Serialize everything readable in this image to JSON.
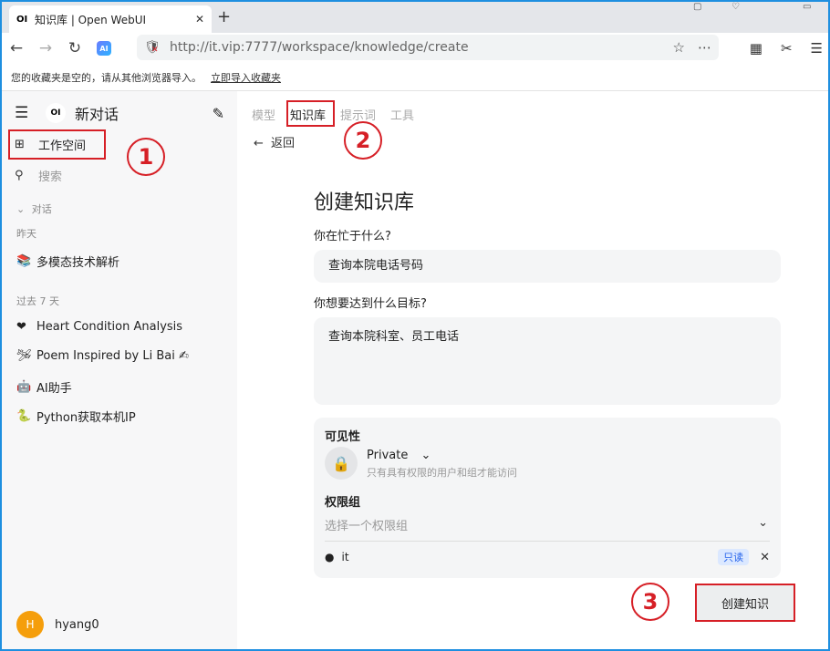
{
  "browser": {
    "tab_title": "知识库 | Open WebUI",
    "tab_logo": "OI",
    "url": "http://it.vip:7777/workspace/knowledge/create",
    "bookmark_notice": "您的收藏夹是空的，请从其他浏览器导入。",
    "bookmark_link": "立即导入收藏夹",
    "ai_label": "AI"
  },
  "sidebar": {
    "new_chat": "新对话",
    "workspace": "工作空间",
    "search": "搜索",
    "section_chats": "对话",
    "section_yesterday": "昨天",
    "section_7days": "过去 7 天",
    "chats_yesterday": [
      {
        "icon": "📚",
        "title": "多模态技术解析"
      }
    ],
    "chats_7days": [
      {
        "icon": "❤",
        "title": "Heart Condition Analysis"
      },
      {
        "icon": "🛩",
        "title": "Poem Inspired by Li Bai ✍"
      },
      {
        "icon": "🤖",
        "title": "AI助手"
      },
      {
        "icon": "🐍",
        "title": "Python获取本机IP"
      }
    ],
    "user_initial": "H",
    "user_name": "hyang0"
  },
  "main": {
    "tabs": [
      "模型",
      "知识库",
      "提示词",
      "工具"
    ],
    "active_tab": "知识库",
    "back": "返回",
    "title": "创建知识库",
    "q1_label": "你在忙于什么?",
    "q1_value": "查询本院电话号码",
    "q2_label": "你想要达到什么目标?",
    "q2_value": "查询本院科室、员工电话",
    "visibility_label": "可见性",
    "visibility_value": "Private",
    "visibility_desc": "只有具有权限的用户和组才能访问",
    "group_label": "权限组",
    "group_placeholder": "选择一个权限组",
    "user": "it",
    "user_badge": "只读",
    "create_button": "创建知识"
  },
  "annotations": [
    "1",
    "2",
    "3"
  ],
  "colors": {
    "annotation": "#d61f26",
    "frame": "#1e8fe0",
    "avatar": "#f59e0b",
    "badge": "#2563eb"
  }
}
